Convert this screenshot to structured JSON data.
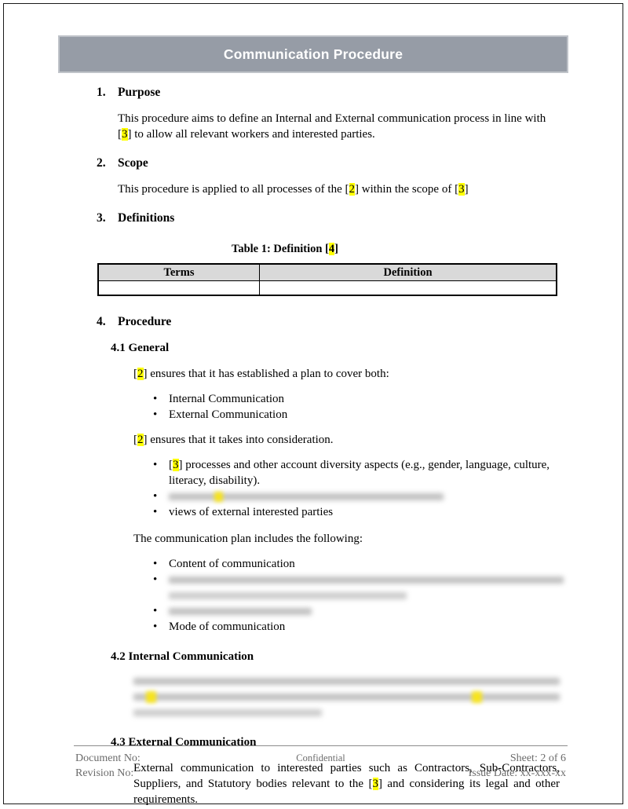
{
  "document": {
    "title": "Communication Procedure"
  },
  "sections": {
    "purpose": {
      "number": "1.",
      "heading": "Purpose",
      "para_a": "This procedure aims to define an Internal and External communication process in line with",
      "ref_1": "3",
      "para_b": "to allow all relevant workers and interested parties."
    },
    "scope": {
      "number": "2.",
      "heading": "Scope",
      "para_a": "This procedure is applied to all processes of the",
      "ref_1": "2",
      "para_b": "within the scope of",
      "ref_2": "3"
    },
    "definitions": {
      "number": "3.",
      "heading": "Definitions",
      "table_caption_a": "Table 1: Definition [",
      "table_caption_ref": "4",
      "table_caption_b": "]",
      "table": {
        "headers": [
          "Terms",
          "Definition"
        ],
        "rows": [
          [
            "",
            ""
          ]
        ]
      }
    },
    "procedure": {
      "number": "4.",
      "heading": "Procedure",
      "general": {
        "heading": "4.1 General",
        "para_1_ref": "2",
        "para_1_text": "ensures that it has established a plan to cover both:",
        "bullets_1": [
          "Internal Communication",
          "External Communication"
        ],
        "para_2_ref": "2",
        "para_2_text": "ensures that it takes into consideration.",
        "bullets_2": [
          {
            "ref": "3",
            "text": "processes and other account diversity aspects (e.g., gender, language, culture, literacy, disability).",
            "redacted": false
          },
          {
            "ref": "",
            "text": "",
            "redacted": true
          },
          {
            "ref": "",
            "text": "views of external interested parties",
            "redacted": false
          }
        ],
        "para_3_text": "The communication plan includes the following:",
        "bullets_3": [
          {
            "text": "Content of communication",
            "redacted": false
          },
          {
            "text": "",
            "redacted": true
          },
          {
            "text": "",
            "redacted": true
          },
          {
            "text": "Mode of communication",
            "redacted": false
          }
        ]
      },
      "internal": {
        "heading": "4.2 Internal Communication",
        "paragraph_redacted": true,
        "paragraph_text": ""
      },
      "external": {
        "heading": "4.3 External Communication",
        "para_a": "External communication to interested parties such as Contractors, Sub-Contractors, Suppliers, and Statutory bodies relevant to the",
        "ref_1": "3",
        "para_b": "and considering its legal and other requirements."
      }
    }
  },
  "footer": {
    "document_no_label": "Document No:",
    "revision_no_label": "Revision No:",
    "confidential": "Confidential",
    "sheet": "Sheet: 2 of 6",
    "issue_date": "Issue Date: xx-xxx-xx"
  },
  "colors": {
    "title_bar": "#969ca6",
    "title_bar_border": "#bfc3c9",
    "table_header": "#d9d9d9",
    "highlight": "#ffff00",
    "footer_text": "#6b6b6b"
  }
}
